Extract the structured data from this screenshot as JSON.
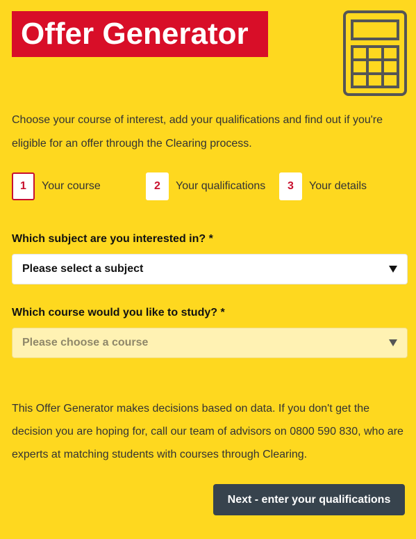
{
  "header": {
    "title": "Offer Generator",
    "icon": "calculator-icon"
  },
  "intro": "Choose your course of interest, add your qualifications and find out if you're eligible for an offer through the Clearing process.",
  "steps": [
    {
      "number": "1",
      "label": "Your course",
      "active": true
    },
    {
      "number": "2",
      "label": "Your qualifications",
      "active": false
    },
    {
      "number": "3",
      "label": "Your details",
      "active": false
    }
  ],
  "form": {
    "subject": {
      "label": "Which subject are you interested in? *",
      "value": "Please select a subject"
    },
    "course": {
      "label": "Which course would you like to study? *",
      "value": "Please choose a course",
      "disabled": true
    }
  },
  "disclaimer": "This Offer Generator makes decisions based on data. If you don't get the decision you are hoping for, call our team of advisors on 0800 590 830, who are experts at matching students with courses through Clearing.",
  "next_button": "Next - enter your qualifications",
  "colors": {
    "background": "#fed81f",
    "brand_red": "#d80e28",
    "button_dark": "#37434d",
    "icon_stroke": "#555555"
  }
}
